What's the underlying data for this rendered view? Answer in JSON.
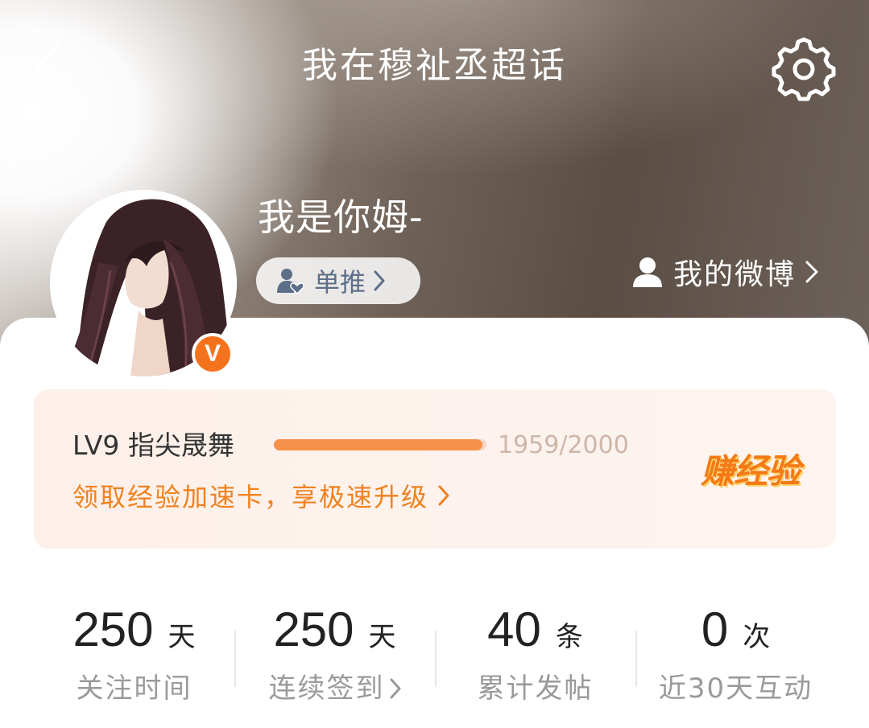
{
  "header": {
    "title": "我在穆祉丞超话"
  },
  "profile": {
    "username": "我是你姆-",
    "verified_badge": "V",
    "tag_label": "单推",
    "my_weibo_label": "我的微博"
  },
  "level": {
    "name": "LV9 指尖晟舞",
    "progress_text": "1959/2000",
    "progress_fraction": 0.9795,
    "speed_link": "领取经验加速卡，享极速升级",
    "earn_label": "赚经验"
  },
  "stats": [
    {
      "value": "250",
      "unit": "天",
      "caption": "关注时间",
      "has_chevron": false
    },
    {
      "value": "250",
      "unit": "天",
      "caption": "连续签到",
      "has_chevron": true
    },
    {
      "value": "40",
      "unit": "条",
      "caption": "累计发帖",
      "has_chevron": false
    },
    {
      "value": "0",
      "unit": "次",
      "caption": "近30天互动",
      "has_chevron": false
    }
  ],
  "colors": {
    "accent_orange": "#f0811f",
    "progress_fill": "#f7914a",
    "badge_orange": "#f5721c",
    "tag_text": "#5d6f88"
  },
  "icons": {
    "back": "chevron-left-icon",
    "settings": "gear-icon",
    "tag": "person-heart-icon",
    "my_weibo": "person-icon"
  }
}
